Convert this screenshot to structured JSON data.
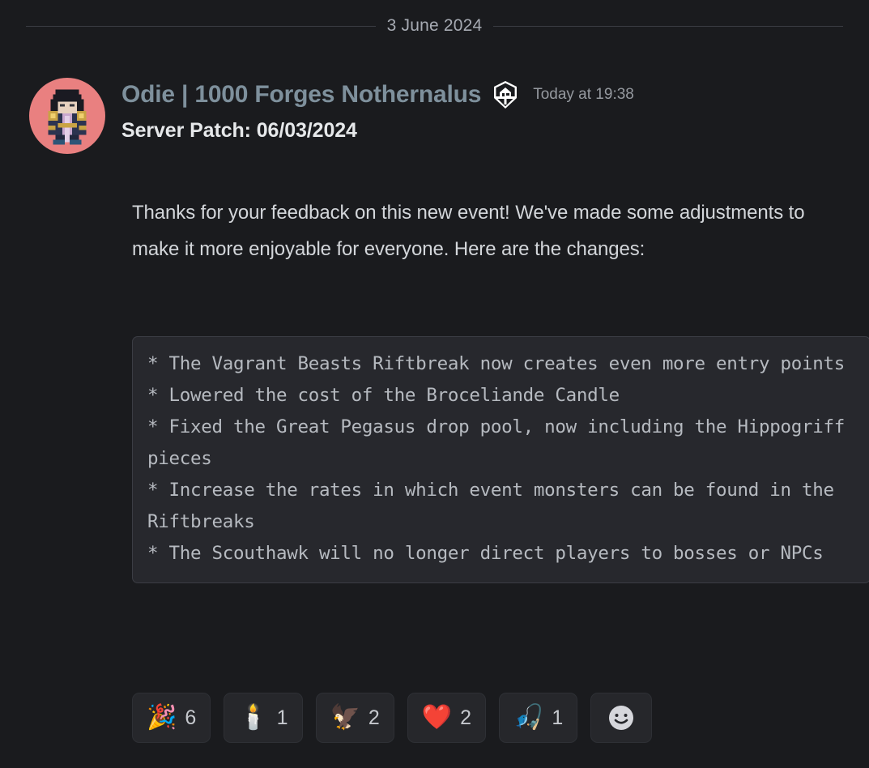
{
  "theme": {
    "background": "#1a1b1e",
    "codeblock_bg": "#27282d",
    "codeblock_border": "#3b3d44",
    "username_color": "#7e909c",
    "avatar_bg": "#e98080",
    "reaction_bg": "#26272b",
    "text_color": "#d3d6da",
    "muted_text": "#95999f"
  },
  "divider": {
    "date": "3 June 2024"
  },
  "message": {
    "avatar_name": "pixel-art-character-avatar",
    "username": "Odie | 1000 Forges Nothernalus",
    "role_badge_name": "forge-shield-badge-icon",
    "timestamp": "Today at 19:38",
    "subject": "Server Patch: 06/03/2024",
    "paragraph": "Thanks for your feedback on this new event! We've made some adjustments to make it more enjoyable for everyone. Here are the changes:",
    "codeblock": "* The Vagrant Beasts Riftbreak now creates even more entry points\n* Lowered the cost of the Broceliande Candle\n* Fixed the Great Pegasus drop pool, now including the Hippogriff pieces\n* Increase the rates in which event monsters can be found in the Riftbreaks\n* The Scouthawk will no longer direct players to bosses or NPCs"
  },
  "reactions": [
    {
      "emoji": "🎉",
      "icon_name": "party-popper-emoji",
      "count": "6"
    },
    {
      "emoji": "🕯️",
      "icon_name": "candle-emoji",
      "count": "1"
    },
    {
      "emoji": "🦅",
      "icon_name": "eagle-emoji",
      "count": "2"
    },
    {
      "emoji": "❤️",
      "icon_name": "red-heart-emoji",
      "count": "2"
    },
    {
      "emoji": "🎣",
      "icon_name": "fishing-pole-emoji",
      "count": "1"
    }
  ],
  "add_reaction": {
    "icon_name": "add-reaction-smiley-icon",
    "label": "☺"
  }
}
